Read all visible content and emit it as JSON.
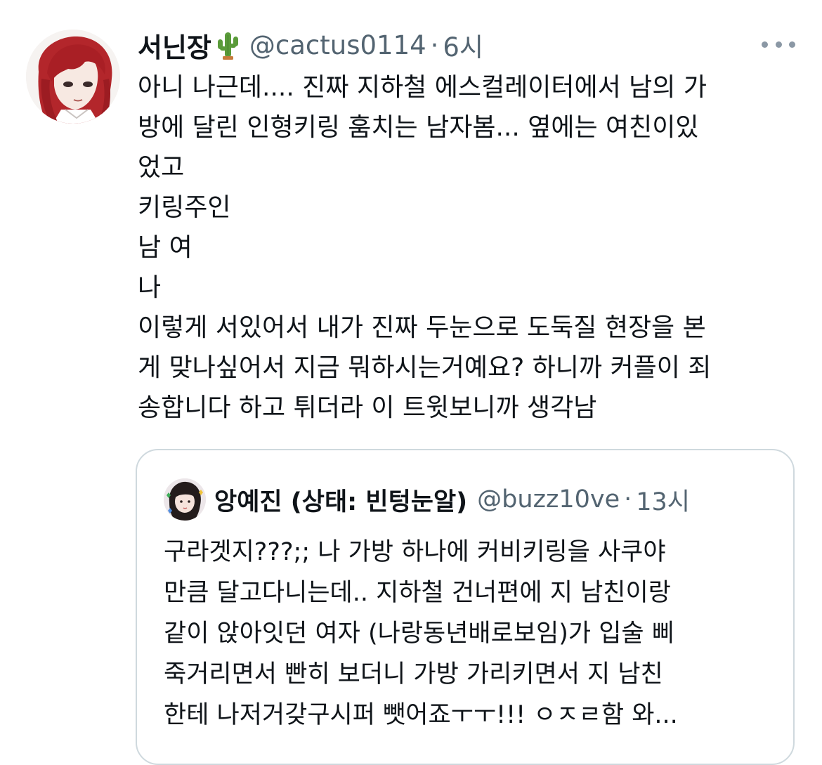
{
  "tweet": {
    "display_name": "서닌장",
    "name_emoji": "cactus-icon",
    "handle": "@cactus0114",
    "separator": "·",
    "time": "6시",
    "more_icon": "more-options-icon",
    "lines": [
      "아니 나근데.... 진짜 지하철 에스컬레이터에서 남의 가",
      "방에 달린 인형키링 훔치는 남자봄... 옆에는 여친이있",
      "었고",
      "키링주인",
      "남 여",
      "나",
      "이렇게 서있어서 내가 진짜 두눈으로 도둑질 현장을 본",
      "게 맞나싶어서 지금 뭐하시는거예요? 하니까 커플이 죄",
      "송합니다 하고 튀더라 이 트윗보니까 생각남"
    ]
  },
  "quoted": {
    "display_name": "앙예진 (상태: 빈텅눈알)",
    "handle": "@buzz10ve",
    "separator": "·",
    "time": "13시",
    "lines": [
      "구라겟지???;; 나 가방 하나에 커비키링을 사쿠야",
      "만큼 달고다니는데.. 지하철 건너편에 지 남친이랑",
      "같이 앉아잇던 여자 (나랑동년배로보임)가 입술 삐",
      "죽거리면서 빤히 보더니 가방 가리키면서  지 남친",
      "한테 나저거갖구시퍼 뺏어죠ㅜㅜ!!! ㅇㅈㄹ함 와..."
    ]
  },
  "colors": {
    "text": "#0f1419",
    "secondary": "#536471",
    "border": "#cfd9de",
    "avatar_hair": "#b3262b"
  }
}
